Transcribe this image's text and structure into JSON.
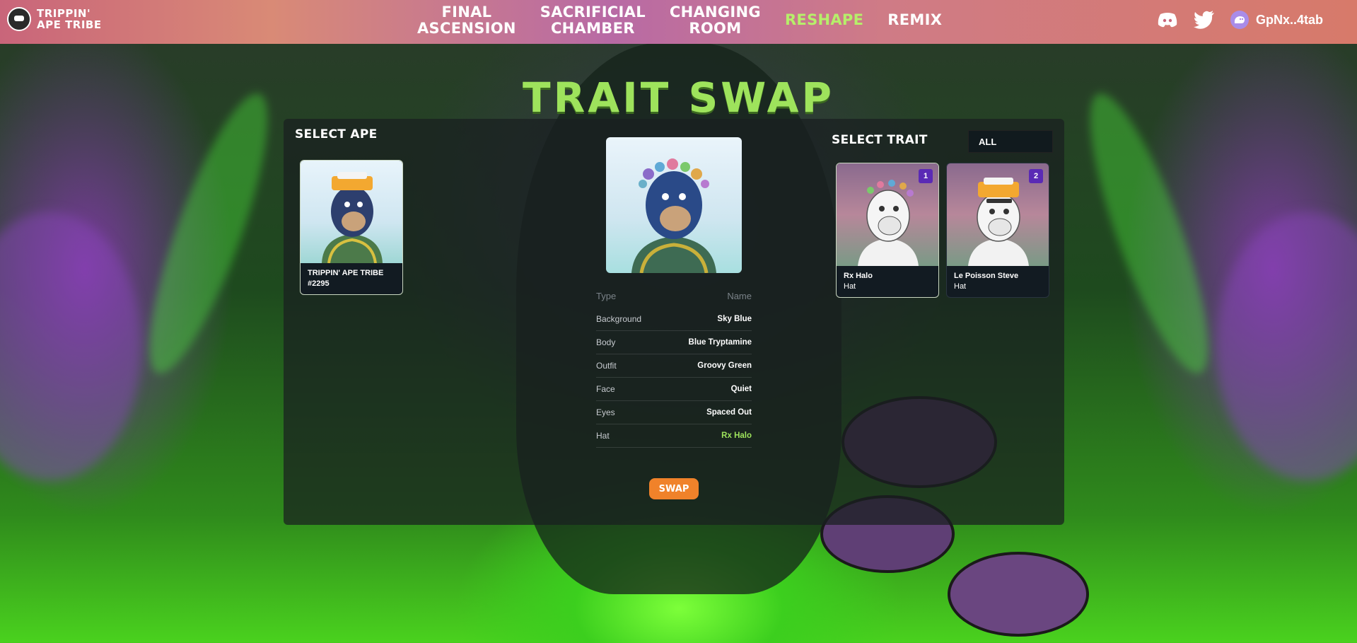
{
  "header": {
    "logo_line1": "TRIPPIN'",
    "logo_line2": "APE TRIBE",
    "nav": [
      {
        "line1": "FINAL",
        "line2": "ASCENSION"
      },
      {
        "line1": "SACRIFICIAL",
        "line2": "CHAMBER"
      },
      {
        "line1": "CHANGING",
        "line2": "ROOM"
      },
      {
        "line1": "ReSHAPE",
        "line2": ""
      },
      {
        "line1": "ReMIX",
        "line2": ""
      }
    ],
    "wallet": "GpNx..4tab"
  },
  "title": "TRAIT SWAP",
  "select_ape": {
    "heading": "SELECT APE",
    "cards": [
      {
        "name": "TRIPPIN' APE TRIBE",
        "number": "#2295"
      }
    ]
  },
  "center": {
    "col_type": "Type",
    "col_name": "Name",
    "rows": [
      {
        "type": "Background",
        "name": "Sky Blue"
      },
      {
        "type": "Body",
        "name": "Blue Tryptamine"
      },
      {
        "type": "Outfit",
        "name": "Groovy Green"
      },
      {
        "type": "Face",
        "name": "Quiet"
      },
      {
        "type": "Eyes",
        "name": "Spaced Out"
      },
      {
        "type": "Hat",
        "name": "Rx Halo"
      }
    ],
    "swap_label": "SWAP"
  },
  "select_trait": {
    "heading": "SELECT TRAIT",
    "filter": "ALL",
    "cards": [
      {
        "badge": "1",
        "name": "Rx Halo",
        "category": "Hat"
      },
      {
        "badge": "2",
        "name": "Le Poisson Steve",
        "category": "Hat"
      }
    ]
  },
  "colors": {
    "accent_green": "#9ee35c",
    "swap_orange": "#f0822a",
    "badge_purple": "#5a2ab5"
  }
}
